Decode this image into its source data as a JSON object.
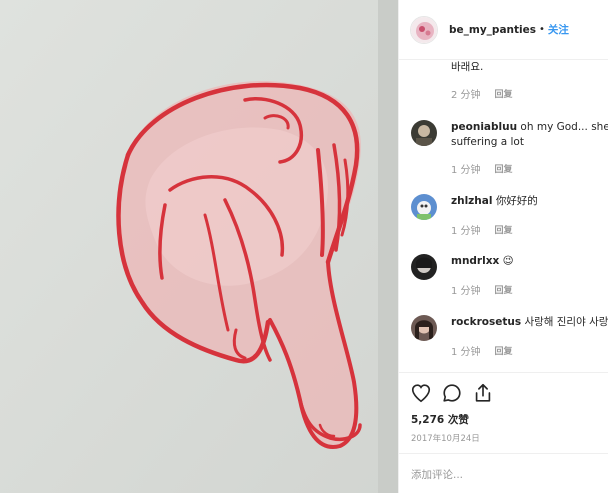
{
  "post": {
    "username": "be_my_panties",
    "separator": "•",
    "follow_label": "关注"
  },
  "comments": [
    {
      "user": "",
      "text": "바래요.",
      "time": "2 分钟",
      "reply": "回复"
    },
    {
      "user": "peoniabluu",
      "text": "oh my God... she",
      "text2": "suffering a lot",
      "time": "1 分钟",
      "reply": "回复"
    },
    {
      "user": "zhlzhal",
      "text": "你好好的",
      "time": "1 分钟",
      "reply": "回复"
    },
    {
      "user": "mndrlxx",
      "text": "😉",
      "time": "1 分钟",
      "reply": "回复"
    },
    {
      "user": "rockrosetus",
      "text": "사랑해 진리야 사랑",
      "time": "1 分钟",
      "reply": "回复"
    }
  ],
  "actions": {
    "icons": [
      "heart-icon",
      "comment-icon",
      "share-icon"
    ],
    "likes": "5,276 次赞",
    "date": "2017年10月24日"
  },
  "add_comment": {
    "placeholder": "添加评论..."
  },
  "colors": {
    "accent": "#3897f0",
    "drawing_red": "#d6333c",
    "paper": "#d9dcd8"
  }
}
